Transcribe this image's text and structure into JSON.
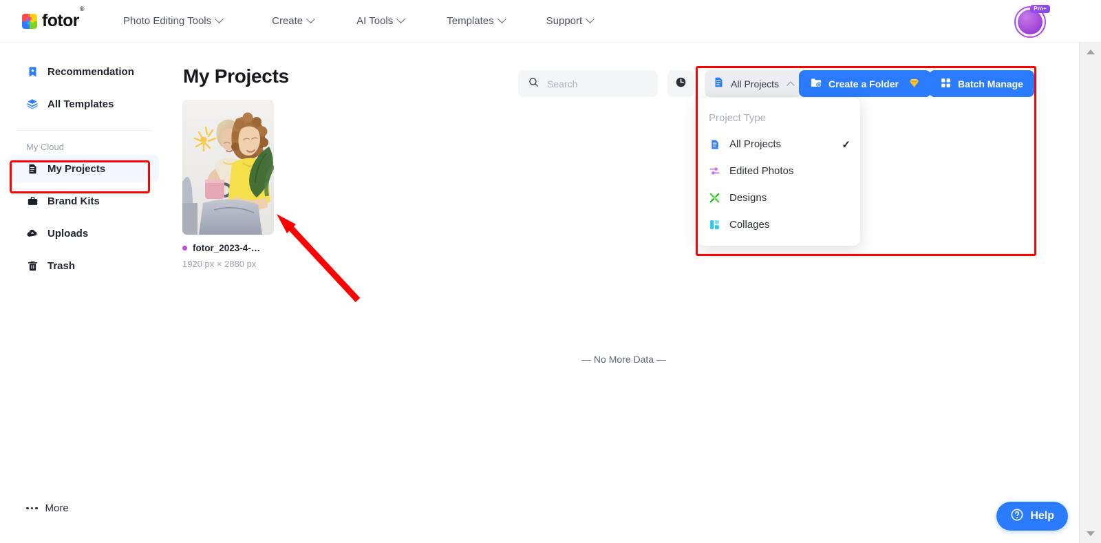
{
  "brand": {
    "name": "fotor",
    "registered": "®"
  },
  "topnav": {
    "items": [
      {
        "label": "Photo Editing Tools",
        "icon": "chevron-down-icon"
      },
      {
        "label": "Create",
        "icon": "chevron-down-icon"
      },
      {
        "label": "AI Tools",
        "icon": "chevron-down-icon"
      },
      {
        "label": "Templates",
        "icon": "chevron-down-icon"
      },
      {
        "label": "Support",
        "icon": "chevron-down-icon"
      }
    ],
    "account": {
      "badge": "Pro+",
      "icon": "avatar-icon"
    }
  },
  "sidebar": {
    "top_items": [
      {
        "label": "Recommendation",
        "icon": "bookmark-star-icon"
      },
      {
        "label": "All Templates",
        "icon": "layers-icon"
      }
    ],
    "section_label": "My Cloud",
    "cloud_items": [
      {
        "label": "My Projects",
        "icon": "document-icon",
        "active": true
      },
      {
        "label": "Brand Kits",
        "icon": "briefcase-icon",
        "active": false
      },
      {
        "label": "Uploads",
        "icon": "cloud-upload-icon",
        "active": false
      },
      {
        "label": "Trash",
        "icon": "trash-icon",
        "active": false
      }
    ],
    "more": {
      "label": "More",
      "icon": "ellipsis-icon"
    }
  },
  "main": {
    "page_title": "My Projects",
    "search": {
      "placeholder": "Search",
      "value": "",
      "icon": "search-icon"
    },
    "history_button": {
      "icon": "clock-history-icon"
    },
    "filter_button": {
      "label": "All Projects",
      "icon": "document-icon",
      "caret": "chevron-up-icon"
    },
    "create_folder_button": {
      "label": "Create a Folder",
      "icon": "folder-plus-icon",
      "badge_icon": "diamond-icon"
    },
    "batch_manage_button": {
      "label": "Batch Manage",
      "icon": "grid-icon"
    },
    "no_more_data": "— No More Data —"
  },
  "dropdown": {
    "header": "Project Type",
    "items": [
      {
        "label": "All Projects",
        "icon": "document-icon",
        "checked": true,
        "check": "✓"
      },
      {
        "label": "Edited Photos",
        "icon": "sliders-icon",
        "checked": false,
        "check": ""
      },
      {
        "label": "Designs",
        "icon": "pencil-ruler-icon",
        "checked": false,
        "check": ""
      },
      {
        "label": "Collages",
        "icon": "collage-icon",
        "checked": false,
        "check": ""
      }
    ]
  },
  "projects": [
    {
      "name": "fotor_2023-4-…",
      "dimensions": "1920 px × 2880 px",
      "status_dot": "#c24ae8"
    }
  ],
  "help": {
    "label": "Help",
    "icon": "question-circle-icon"
  },
  "annotations": {
    "highlight_boxes": 2,
    "arrow_color": "#ff0000",
    "box_color": "#ff0000"
  },
  "colors": {
    "accent_blue": "#2b7bff",
    "sidebar_active_bg": "#f3f7ff",
    "annotation_red": "#ff0000",
    "purple_dot": "#c24ae8"
  }
}
